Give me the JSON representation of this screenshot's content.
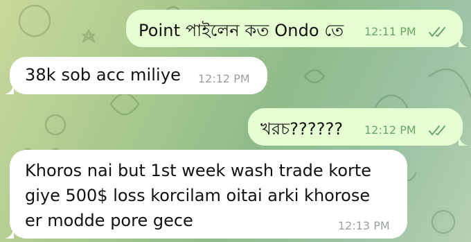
{
  "chat": {
    "messages": [
      {
        "direction": "outgoing",
        "text": "Point পাইলেন কত Ondo তে",
        "time": "12:11 PM",
        "status": "read"
      },
      {
        "direction": "incoming",
        "text": "38k sob acc miliye",
        "time": "12:12 PM"
      },
      {
        "direction": "outgoing",
        "text": "খরচ??????",
        "time": "12:12 PM",
        "status": "read"
      },
      {
        "direction": "incoming",
        "lines": [
          "Khoros nai but 1st week wash trade korte",
          "giye 500$ loss korcilam oitai arki khorose",
          "er modde pore gece"
        ],
        "time": "12:13 PM"
      }
    ]
  },
  "icons": {
    "read_status": "double-check-icon"
  },
  "colors": {
    "outgoing_bubble": "#e6ffd2",
    "incoming_bubble": "#ffffff",
    "outgoing_meta": "#6aa564",
    "incoming_meta": "#9aa0a4"
  }
}
